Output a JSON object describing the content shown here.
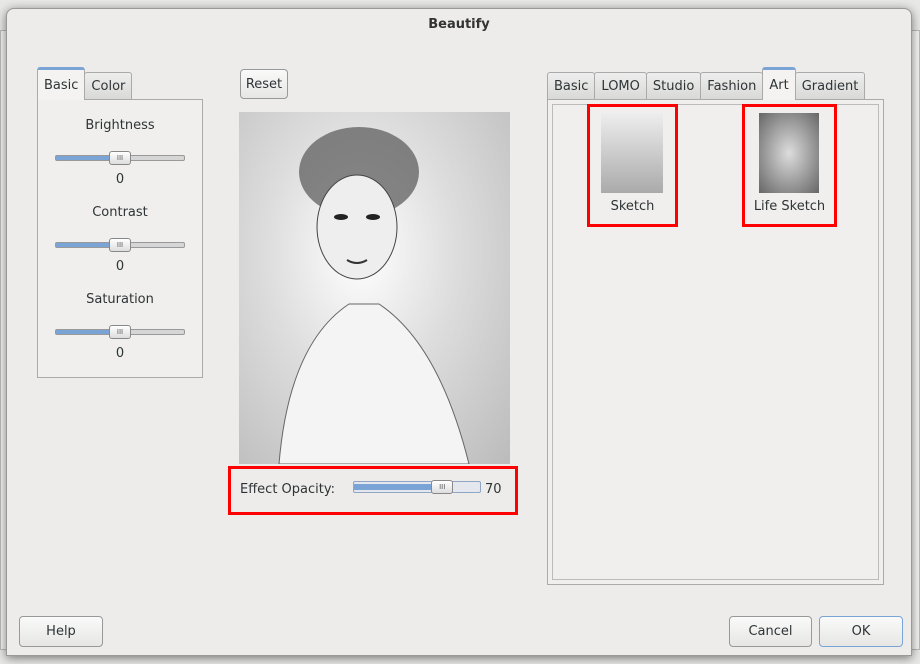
{
  "dialog": {
    "title": "Beautify"
  },
  "left_tabs": [
    {
      "label": "Basic",
      "active": true
    },
    {
      "label": "Color",
      "active": false
    }
  ],
  "adjustments": [
    {
      "label": "Brightness",
      "value": 0,
      "min": -100,
      "max": 100
    },
    {
      "label": "Contrast",
      "value": 0,
      "min": -100,
      "max": 100
    },
    {
      "label": "Saturation",
      "value": 0,
      "min": -100,
      "max": 100
    }
  ],
  "reset_label": "Reset",
  "opacity": {
    "label": "Effect Opacity:",
    "value": 70,
    "value_text": "70",
    "max": 100
  },
  "right_tabs": [
    {
      "label": "Basic"
    },
    {
      "label": "LOMO"
    },
    {
      "label": "Studio"
    },
    {
      "label": "Fashion"
    },
    {
      "label": "Art",
      "active": true
    },
    {
      "label": "Gradient"
    }
  ],
  "effects": [
    {
      "label": "Sketch"
    },
    {
      "label": "Life Sketch"
    }
  ],
  "buttons": {
    "help": "Help",
    "cancel": "Cancel",
    "ok": "OK"
  },
  "colors": {
    "accent": "#7aa4d6",
    "highlight": "#ff0000"
  }
}
